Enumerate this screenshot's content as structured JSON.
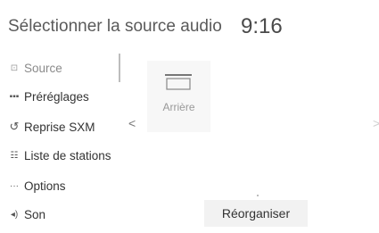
{
  "header": {
    "title": "Sélectionner la source audio",
    "clock": "9:16"
  },
  "sidebar": {
    "items": [
      {
        "label": "Source",
        "icon": "source-icon",
        "active": true
      },
      {
        "label": "Préréglages",
        "icon": "presets-icon",
        "active": false
      },
      {
        "label": "Reprise SXM",
        "icon": "replay-icon",
        "active": false
      },
      {
        "label": "Liste de stations",
        "icon": "station-list-icon",
        "active": false
      },
      {
        "label": "Options",
        "icon": "options-icon",
        "active": false
      },
      {
        "label": "Son",
        "icon": "speaker-icon",
        "active": false
      }
    ]
  },
  "main": {
    "source_tile": {
      "label": "Arrière",
      "icon": "rear-source-icon"
    },
    "left_arrow": "<",
    "right_arrow": ">",
    "reorganize_label": "Réorganiser"
  }
}
